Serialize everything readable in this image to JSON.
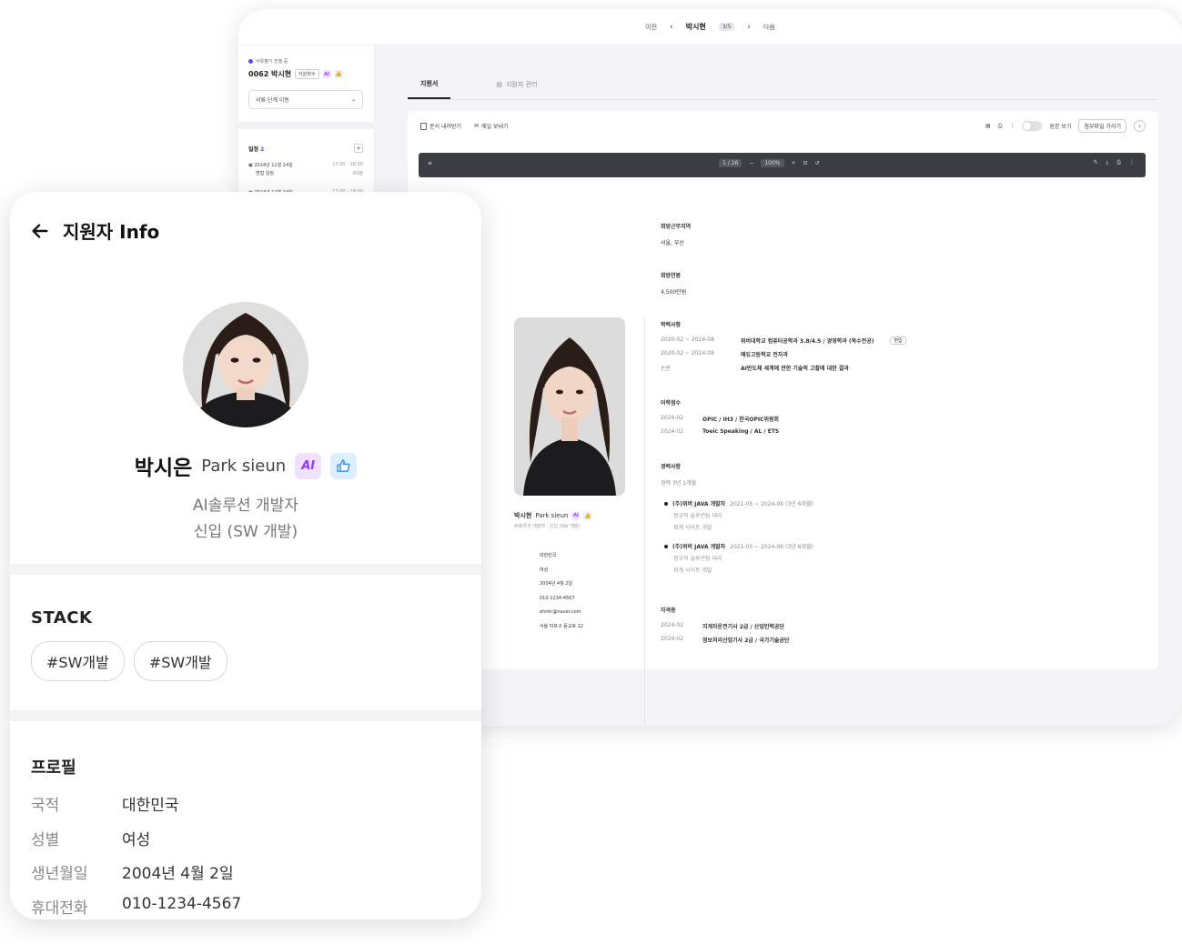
{
  "back": {
    "topbar": {
      "prev": "이전",
      "current": "박시현",
      "page": "3/5",
      "next": "다음"
    },
    "sidebar": {
      "status": "서류평가 진행 중",
      "name": "0062 박시현",
      "tag": "지원횟수",
      "select_value": "서류 단계 이동",
      "schedule_label": "일정",
      "schedule_count": "2",
      "items": [
        {
          "date": "2024년 12월 24일",
          "time": "17:00 - 18:00",
          "sub": "면접 일정",
          "sub_time": "60분"
        },
        {
          "date": "2024년 12월 24일",
          "time": "17:00 - 18:00"
        }
      ]
    },
    "tabs": [
      {
        "label": "지원서"
      },
      {
        "label": "지원자 관리"
      }
    ],
    "doc_actions": [
      "문서 내려받기",
      "메일 보내기"
    ],
    "doc_right": {
      "toggle_label": "원본 보기",
      "button": "첨부파일 가리기"
    },
    "pdf": {
      "page": "1",
      "total": "26",
      "zoom": "100%"
    },
    "resume": {
      "left_name": "박시현",
      "left_en": "Park sieun",
      "left_role": "AI솔루션 개발자 · 신입 (SW 개발)",
      "left_info": [
        "대한민국",
        "여성",
        "2004년 4월 2일",
        "010-1234-4567",
        "ehnkr@naver.com",
        "서울 마포구 동교로 12"
      ],
      "sections": {
        "region": {
          "h": "희망근무지역",
          "v": "서울, 부산"
        },
        "salary": {
          "h": "희망연봉",
          "v": "4,500만원"
        },
        "education": {
          "h": "학력사항",
          "rows": [
            {
              "d": "2020-02 ~ 2024-08",
              "v": "위버대학교 컴퓨터공학과 3.8/4.5 / 경영학과 (복수전공)",
              "tag": "편입"
            },
            {
              "d": "2020-02 ~ 2024-08",
              "v": "애듀고등학교 전자과"
            },
            {
              "d": "논문",
              "v": "AI반도체 세계에 관한 기술적 고찰에 대한 결과"
            }
          ]
        },
        "language": {
          "h": "어학점수",
          "rows": [
            {
              "d": "2024-02",
              "v": "OPIC / IH3 / 한국OPIC위원회"
            },
            {
              "d": "2024-02",
              "v": "Toeic Speaking / AL / ETS"
            }
          ]
        },
        "career": {
          "h": "경력사항",
          "total": "경력 3년 1개월",
          "items": [
            {
              "title": "(주)위버 JAVA 개발자",
              "period": "2021-05 ~ 2024-06 (3년 6개월)",
              "l1": "정규직 솔루션팀 대리",
              "l2": "회계 사이트 개발"
            },
            {
              "title": "(주)위버 JAVA 개발자",
              "period": "2021-05 ~ 2024-06 (3년 6개월)",
              "l1": "정규직 솔루션팀 대리",
              "l2": "회계 사이트 개발"
            }
          ]
        },
        "license": {
          "h": "자격증",
          "rows": [
            {
              "d": "2024-02",
              "v": "지게차운전기사 2급 / 산업인력공단"
            },
            {
              "d": "2024-02",
              "v": "정보처리산업기사 2급 / 국가기술공단"
            }
          ]
        }
      }
    }
  },
  "front": {
    "title": "지원자 Info",
    "name_ko": "박시은",
    "name_en": "Park sieun",
    "badge_ai": "AI",
    "role_line1": "AI솔루션 개발자",
    "role_line2": "신입 (SW 개발)",
    "stack_title": "STACK",
    "stack": [
      "#SW개발",
      "#SW개발"
    ],
    "profile_title": "프로필",
    "profile": [
      {
        "k": "국적",
        "v": "대한민국"
      },
      {
        "k": "성별",
        "v": "여성"
      },
      {
        "k": "생년월일",
        "v": "2004년 4월 2일"
      },
      {
        "k": "휴대전화",
        "v": "010-1234-4567"
      }
    ]
  },
  "colors": {
    "accent": "#5b4bff",
    "ai_badge": "#a034ff",
    "like_badge": "#2f8ef0",
    "pdf_bar": "#3a3d42"
  }
}
